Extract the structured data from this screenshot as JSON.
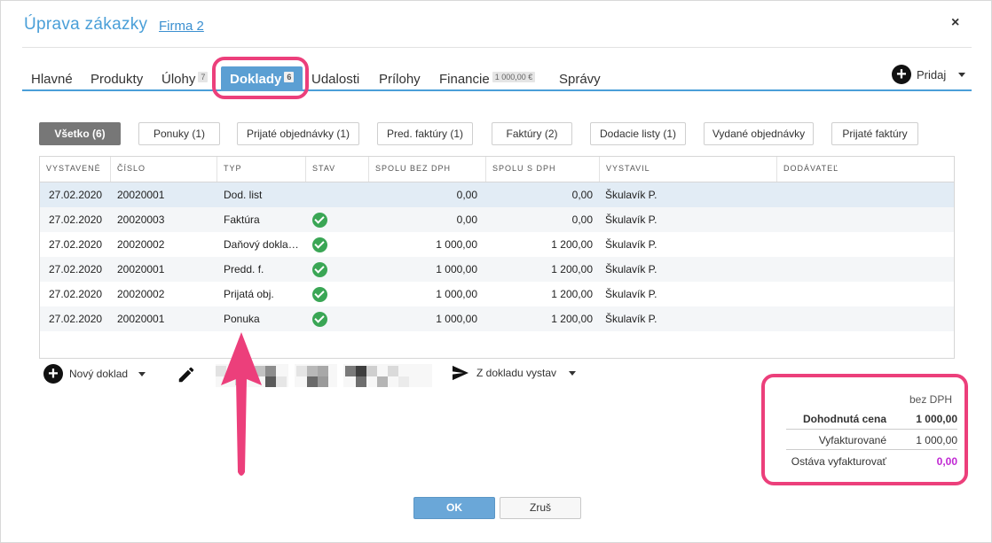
{
  "dialog": {
    "title": "Úprava zákazky",
    "firm_link": "Firma 2",
    "close_symbol": "×"
  },
  "tabs": [
    {
      "label": "Hlavné",
      "badge": ""
    },
    {
      "label": "Produkty",
      "badge": ""
    },
    {
      "label": "Úlohy",
      "badge": "7"
    },
    {
      "label": "Doklady",
      "badge": "6",
      "active": true
    },
    {
      "label": "Udalosti",
      "badge": ""
    },
    {
      "label": "Prílohy",
      "badge": ""
    },
    {
      "label": "Financie",
      "badge": "1 000,00 €"
    },
    {
      "label": "Správy",
      "badge": ""
    }
  ],
  "add_button": {
    "label": "Pridaj",
    "icon": "plus-circle-icon"
  },
  "filters": [
    {
      "label": "Všetko (6)",
      "active": true
    },
    {
      "label": "Ponuky (1)"
    },
    {
      "label": "Prijaté objednávky (1)"
    },
    {
      "label": "Pred. faktúry (1)"
    },
    {
      "label": "Faktúry (2)"
    },
    {
      "label": "Dodacie listy (1)"
    },
    {
      "label": "Vydané objednávky"
    },
    {
      "label": "Prijaté faktúry"
    }
  ],
  "table": {
    "columns": [
      "VYSTAVENÉ",
      "ČÍSLO",
      "TYP",
      "STAV",
      "SPOLU BEZ DPH",
      "SPOLU S DPH",
      "VYSTAVIL",
      "DODÁVATEĽ"
    ],
    "rows": [
      {
        "date": "27.02.2020",
        "number": "20020001",
        "type": "Dod. list",
        "status": "",
        "net": "0,00",
        "gross": "0,00",
        "issuer": "Škulavík P.",
        "supplier": "",
        "selected": true
      },
      {
        "date": "27.02.2020",
        "number": "20020003",
        "type": "Faktúra",
        "status": "ok",
        "net": "0,00",
        "gross": "0,00",
        "issuer": "Škulavík P.",
        "supplier": ""
      },
      {
        "date": "27.02.2020",
        "number": "20020002",
        "type": "Daňový dokla…",
        "status": "ok",
        "net": "1 000,00",
        "gross": "1 200,00",
        "issuer": "Škulavík P.",
        "supplier": ""
      },
      {
        "date": "27.02.2020",
        "number": "20020001",
        "type": "Predd. f.",
        "status": "ok",
        "net": "1 000,00",
        "gross": "1 200,00",
        "issuer": "Škulavík P.",
        "supplier": ""
      },
      {
        "date": "27.02.2020",
        "number": "20020002",
        "type": "Prijatá obj.",
        "status": "ok",
        "net": "1 000,00",
        "gross": "1 200,00",
        "issuer": "Škulavík P.",
        "supplier": ""
      },
      {
        "date": "27.02.2020",
        "number": "20020001",
        "type": "Ponuka",
        "status": "ok",
        "net": "1 000,00",
        "gross": "1 200,00",
        "issuer": "Škulavík P.",
        "supplier": ""
      }
    ]
  },
  "actions": {
    "new_doc_label": "Nový doklad",
    "send_label": "Z dokladu vystav"
  },
  "summary": {
    "header": "bez DPH",
    "agreed_label": "Dohodnutá cena",
    "agreed_value": "1 000,00",
    "invoiced_label": "Vyfakturované",
    "invoiced_value": "1 000,00",
    "remaining_label": "Ostáva vyfakturovať",
    "remaining_value": "0,00"
  },
  "footer": {
    "ok_label": "OK",
    "cancel_label": "Zruš"
  },
  "colors": {
    "accent": "#5b9fd3",
    "highlight": "#ec3f7b",
    "status_ok": "#3aa655",
    "remaining": "#c026d3"
  }
}
